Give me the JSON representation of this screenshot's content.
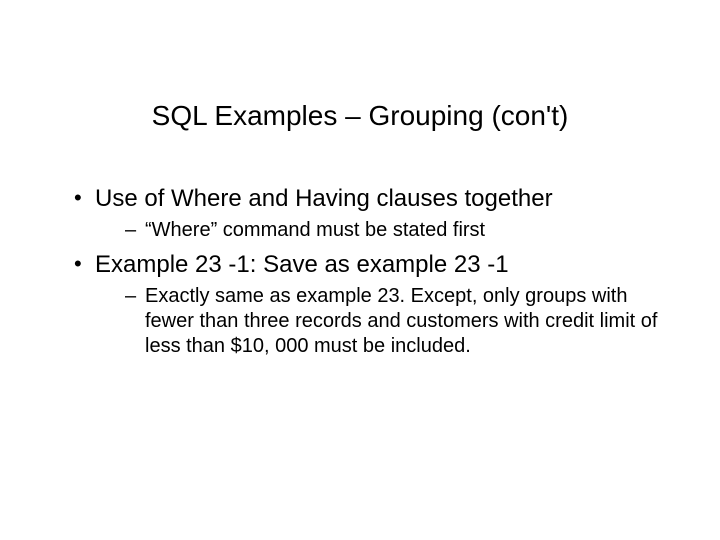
{
  "slide": {
    "title": "SQL Examples – Grouping (con't)",
    "bullets": [
      {
        "text": "Use of Where and Having clauses together",
        "sub": [
          "“Where” command must be stated first"
        ]
      },
      {
        "text": "Example 23 -1: Save as example 23 -1",
        "sub": [
          "Exactly same as example 23. Except, only groups with fewer than three records and customers with credit limit of less than $10, 000 must be included."
        ]
      }
    ]
  }
}
